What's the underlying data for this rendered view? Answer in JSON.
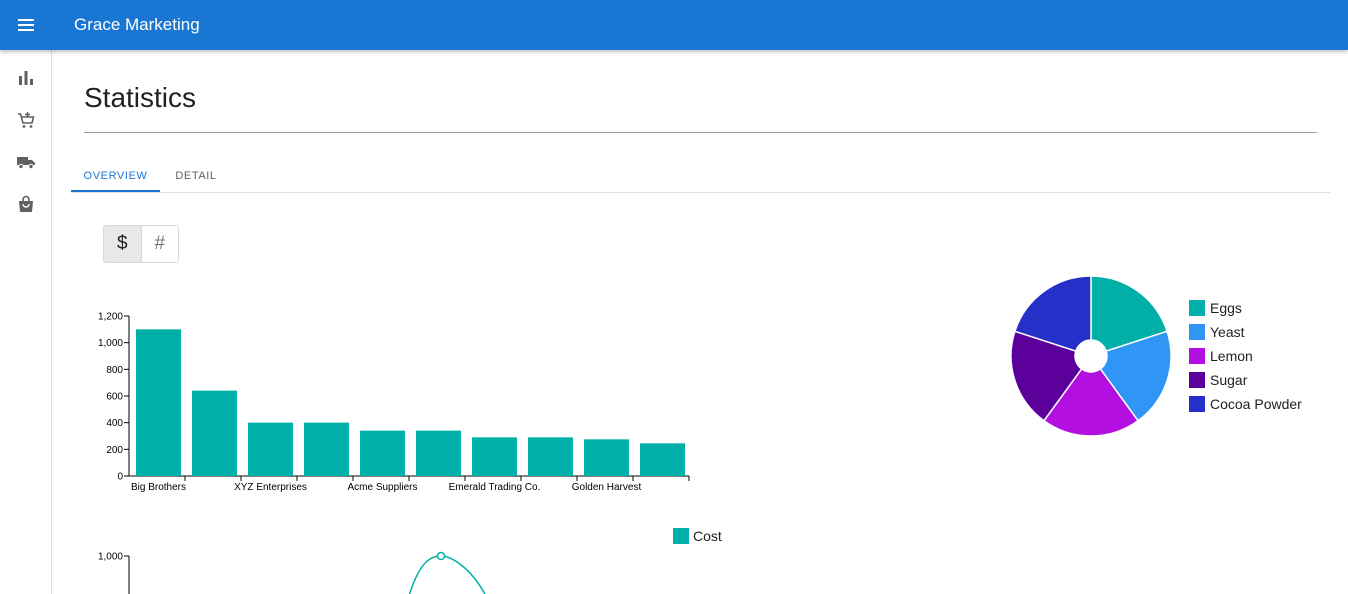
{
  "app": {
    "title": "Grace Marketing",
    "menu_icon": "menu-icon"
  },
  "sidebar": {
    "items": [
      {
        "icon": "bar-chart-icon"
      },
      {
        "icon": "add-shopping-cart-icon"
      },
      {
        "icon": "local-shipping-icon"
      },
      {
        "icon": "shopping-bag-icon"
      }
    ]
  },
  "page": {
    "title": "Statistics"
  },
  "tabs": [
    {
      "label": "OVERVIEW",
      "active": true
    },
    {
      "label": "DETAIL",
      "active": false
    }
  ],
  "toggle": {
    "options": [
      {
        "label": "$",
        "active": true
      },
      {
        "label": "#",
        "active": false
      }
    ]
  },
  "colors": {
    "primary": "#1976d2",
    "bar": "#00b0a8"
  },
  "chart_data": [
    {
      "type": "bar",
      "categories": [
        "Big Brothers",
        "",
        "XYZ Enterprises",
        "",
        "Acme Suppliers",
        "",
        "Emerald Trading Co.",
        "",
        "Golden Harvest",
        ""
      ],
      "values": [
        1100,
        640,
        400,
        400,
        340,
        340,
        290,
        290,
        275,
        245
      ],
      "ylim": [
        0,
        1200
      ],
      "yticks": [
        0,
        200,
        400,
        600,
        800,
        1000,
        1200
      ],
      "ytick_labels": [
        "0",
        "200",
        "400",
        "600",
        "800",
        "1,000",
        "1,200"
      ],
      "color": "#00b0a8"
    },
    {
      "type": "pie",
      "labels": [
        "Eggs",
        "Yeast",
        "Lemon",
        "Sugar",
        "Cocoa Powder"
      ],
      "values": [
        20,
        20,
        20,
        20,
        20
      ],
      "colors": [
        "#00b0a8",
        "#2f96f5",
        "#b20fe0",
        "#5c009c",
        "#2530c8"
      ],
      "legend": "right",
      "donut": true
    },
    {
      "type": "line",
      "series": [
        {
          "name": "Cost",
          "color": "#00b0a8",
          "peak": 1000
        }
      ],
      "yticks": [
        1000
      ],
      "ytick_labels": [
        "1,000"
      ],
      "legend": "top"
    }
  ]
}
